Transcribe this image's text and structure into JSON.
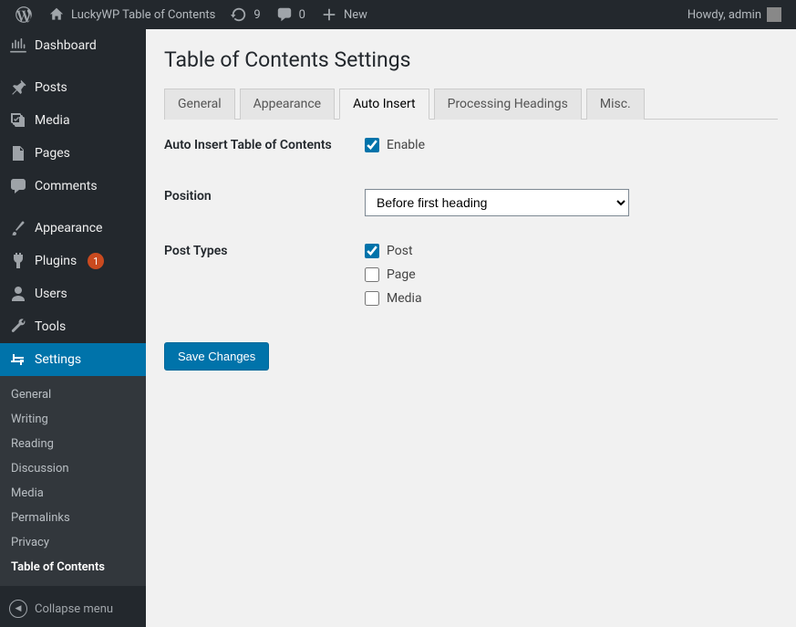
{
  "topbar": {
    "site_title": "LuckyWP Table of Contents",
    "updates_count": "9",
    "comments_count": "0",
    "new_label": "New",
    "howdy": "Howdy, admin"
  },
  "sidebar": {
    "items": [
      {
        "label": "Dashboard"
      },
      {
        "label": "Posts"
      },
      {
        "label": "Media"
      },
      {
        "label": "Pages"
      },
      {
        "label": "Comments"
      },
      {
        "label": "Appearance"
      },
      {
        "label": "Plugins",
        "badge": "1"
      },
      {
        "label": "Users"
      },
      {
        "label": "Tools"
      },
      {
        "label": "Settings"
      }
    ],
    "submenu": [
      "General",
      "Writing",
      "Reading",
      "Discussion",
      "Media",
      "Permalinks",
      "Privacy",
      "Table of Contents"
    ],
    "collapse": "Collapse menu"
  },
  "page": {
    "title": "Table of Contents Settings"
  },
  "tabs": [
    "General",
    "Appearance",
    "Auto Insert",
    "Processing Headings",
    "Misc."
  ],
  "form": {
    "auto_insert_label": "Auto Insert Table of Contents",
    "auto_insert_enable": "Enable",
    "position_label": "Position",
    "position_value": "Before first heading",
    "post_types_label": "Post Types",
    "post_types": [
      {
        "label": "Post",
        "checked": true
      },
      {
        "label": "Page",
        "checked": false
      },
      {
        "label": "Media",
        "checked": false
      }
    ],
    "save_button": "Save Changes"
  }
}
